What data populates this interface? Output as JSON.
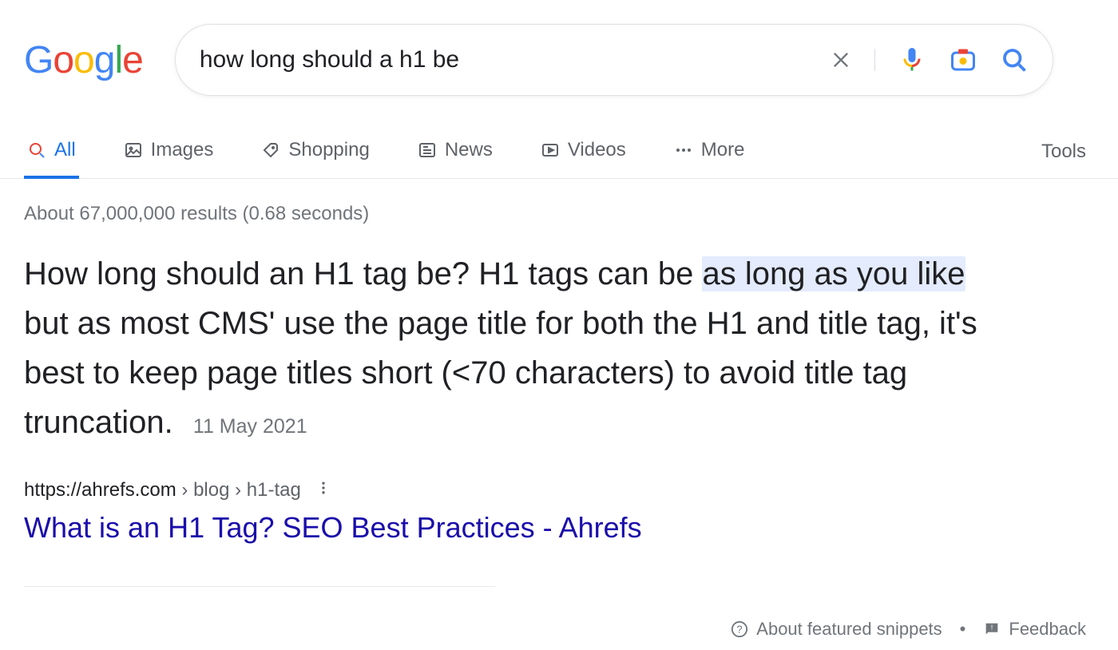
{
  "search": {
    "query": "how long should a h1 be"
  },
  "tabs": {
    "all": "All",
    "images": "Images",
    "shopping": "Shopping",
    "news": "News",
    "videos": "Videos",
    "more": "More",
    "tools": "Tools"
  },
  "stats": "About 67,000,000 results (0.68 seconds)",
  "snippet": {
    "pre": "How long should an H1 tag be? H1 tags can be ",
    "highlight": "as long as you like",
    "post": " but as most CMS' use the page title for both the H1 and title tag, it's best to keep page titles short (<70 characters) to avoid title tag truncation.",
    "date": "11 May 2021"
  },
  "source": {
    "domain": "https://ahrefs.com",
    "path": " › blog › h1-tag",
    "title": "What is an H1 Tag? SEO Best Practices - Ahrefs"
  },
  "footer": {
    "about": "About featured snippets",
    "feedback": "Feedback"
  }
}
